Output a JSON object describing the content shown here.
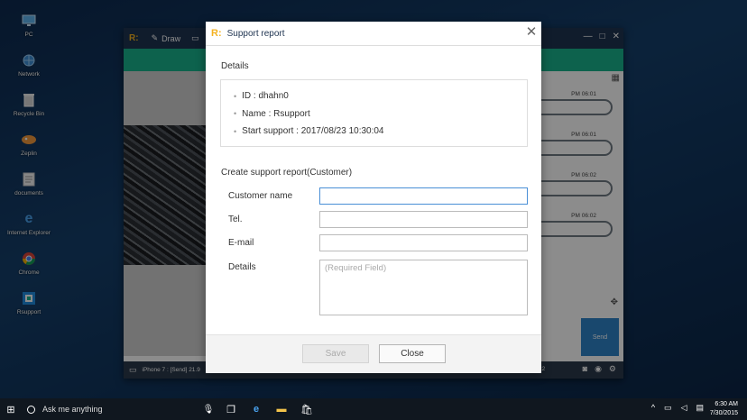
{
  "desktop": {
    "icons": [
      {
        "label": "PC",
        "icon": "pc-icon"
      },
      {
        "label": "Network",
        "icon": "network-icon"
      },
      {
        "label": "Recycle Bin",
        "icon": "recycle-bin-icon"
      },
      {
        "label": "Zeplin",
        "icon": "zeplin-icon"
      },
      {
        "label": "documents",
        "icon": "folder-icon"
      },
      {
        "label": "Internet Explorer",
        "icon": "ie-icon"
      },
      {
        "label": "Chrome",
        "icon": "chrome-icon"
      },
      {
        "label": "Rsupport",
        "icon": "rsupport-icon"
      }
    ]
  },
  "app": {
    "logo": "R:",
    "toolbar": {
      "draw_label": "Draw"
    },
    "chat_times": [
      "PM 06:01",
      "PM 06:01",
      "PM 06:02",
      "PM 06:02"
    ],
    "send_label": "Send",
    "status_text": "iPhone 7 : [Send] 21.9",
    "status_time_tail": "22",
    "brand_color": "#19b28d",
    "titlebar_color": "#1e3350"
  },
  "dialog": {
    "logo": "R:",
    "title": "Support report",
    "details_heading": "Details",
    "details": {
      "id_line": "ID : dhahn0",
      "name_line": "Name : Rsupport",
      "start_line": "Start support : 2017/08/23 10:30:04"
    },
    "form_heading": "Create support report(Customer)",
    "form": {
      "customer_name_label": "Customer name",
      "customer_name_value": "",
      "tel_label": "Tel.",
      "tel_value": "",
      "email_label": "E-mail",
      "email_value": "",
      "details_label": "Details",
      "details_placeholder": "(Required Field)"
    },
    "buttons": {
      "save": "Save",
      "close": "Close"
    }
  },
  "taskbar": {
    "search_placeholder": "Ask me anything",
    "clock_time": "6:30 AM",
    "clock_date": "7/30/2015"
  }
}
